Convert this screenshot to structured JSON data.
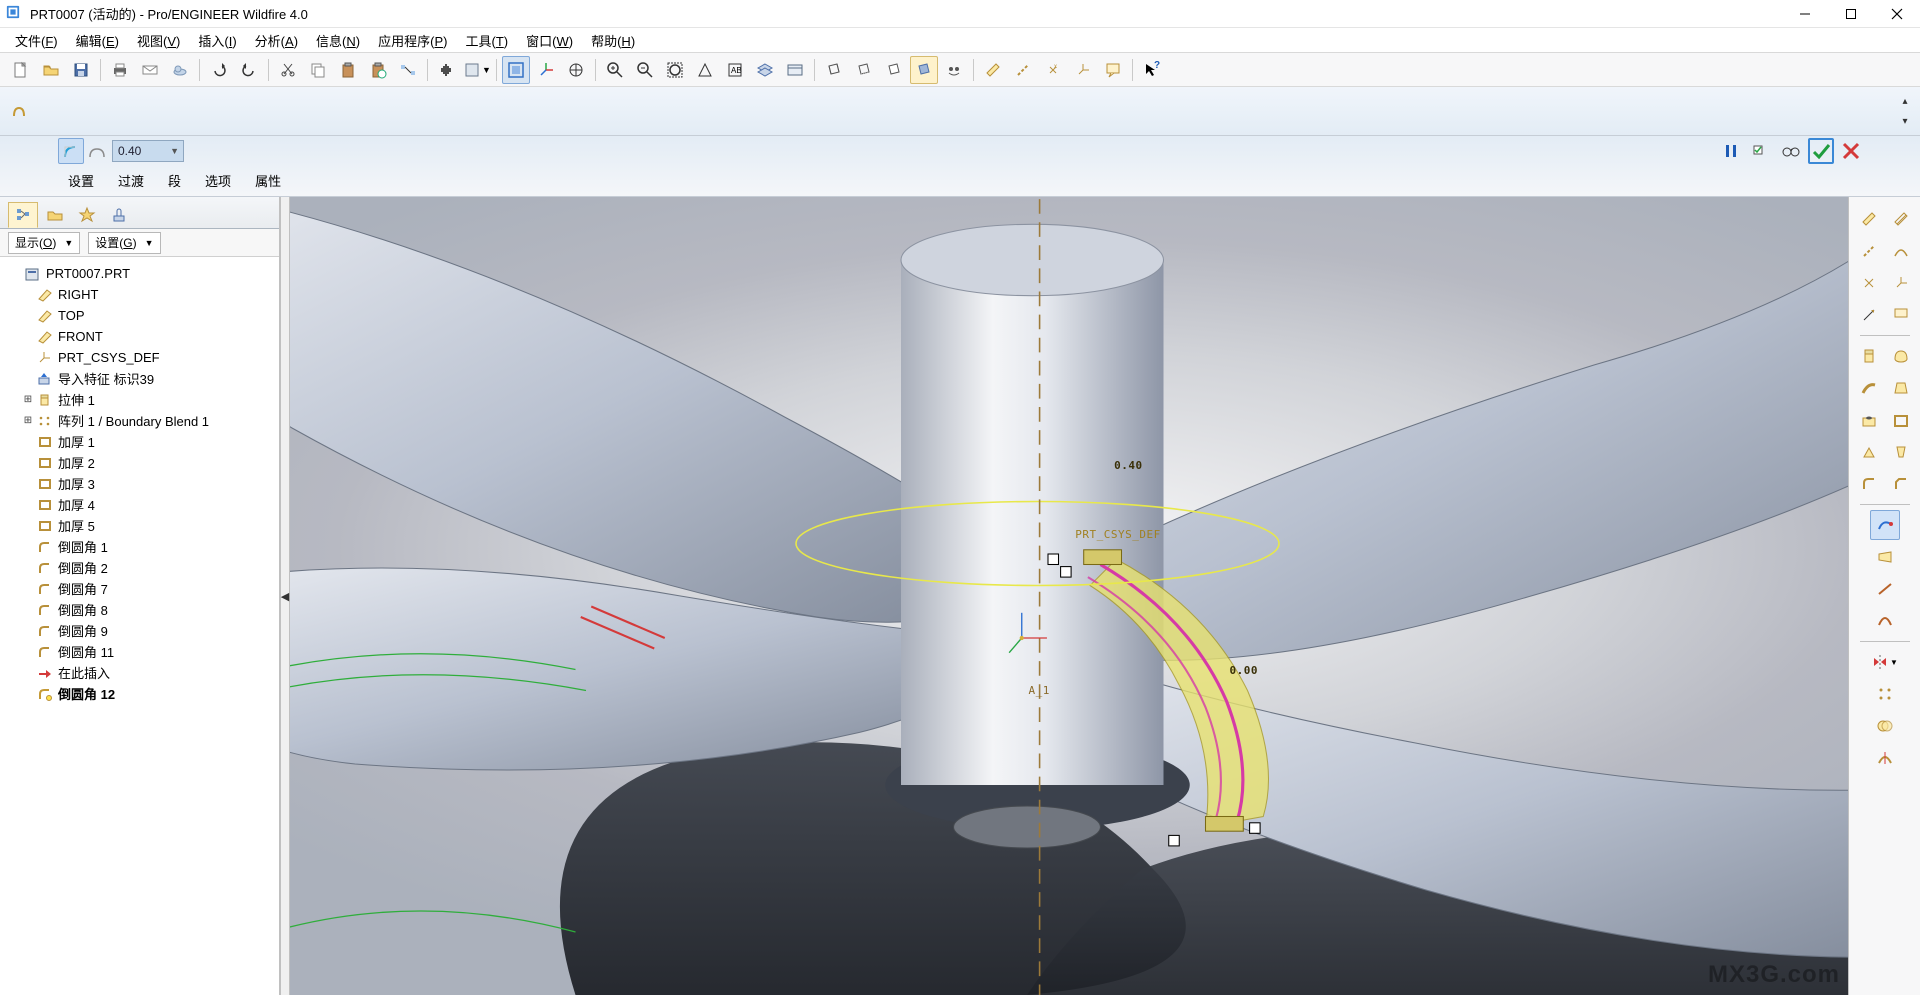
{
  "titlebar": {
    "title": "PRT0007 (活动的) - Pro/ENGINEER Wildfire 4.0"
  },
  "menubar": {
    "items": [
      {
        "label": "文件",
        "mn": "F"
      },
      {
        "label": "编辑",
        "mn": "E"
      },
      {
        "label": "视图",
        "mn": "V"
      },
      {
        "label": "插入",
        "mn": "I"
      },
      {
        "label": "分析",
        "mn": "A"
      },
      {
        "label": "信息",
        "mn": "N"
      },
      {
        "label": "应用程序",
        "mn": "P"
      },
      {
        "label": "工具",
        "mn": "T"
      },
      {
        "label": "窗口",
        "mn": "W"
      },
      {
        "label": "帮助",
        "mn": "H"
      }
    ]
  },
  "dashboard": {
    "value_field": "0.40",
    "tabs": [
      {
        "label": "设置"
      },
      {
        "label": "过渡"
      },
      {
        "label": "段"
      },
      {
        "label": "选项"
      },
      {
        "label": "属性"
      }
    ]
  },
  "tree_filters": {
    "display_label": "显示",
    "display_mn": "O",
    "settings_label": "设置",
    "settings_mn": "G"
  },
  "model_tree": {
    "root": "PRT0007.PRT",
    "items": [
      {
        "type": "datum-plane",
        "label": "RIGHT",
        "level": 2
      },
      {
        "type": "datum-plane",
        "label": "TOP",
        "level": 2
      },
      {
        "type": "datum-plane",
        "label": "FRONT",
        "level": 2
      },
      {
        "type": "csys",
        "label": "PRT_CSYS_DEF",
        "level": 2
      },
      {
        "type": "import",
        "label": "导入特征 标识39",
        "level": 2
      },
      {
        "type": "extrude",
        "label": "拉伸 1",
        "level": 2,
        "expandable": true
      },
      {
        "type": "pattern",
        "label": "阵列 1 / Boundary Blend 1",
        "level": 2,
        "expandable": true
      },
      {
        "type": "thicken",
        "label": "加厚 1",
        "level": 2
      },
      {
        "type": "thicken",
        "label": "加厚 2",
        "level": 2
      },
      {
        "type": "thicken",
        "label": "加厚 3",
        "level": 2
      },
      {
        "type": "thicken",
        "label": "加厚 4",
        "level": 2
      },
      {
        "type": "thicken",
        "label": "加厚 5",
        "level": 2
      },
      {
        "type": "round",
        "label": "倒圆角 1",
        "level": 2
      },
      {
        "type": "round",
        "label": "倒圆角 2",
        "level": 2
      },
      {
        "type": "round",
        "label": "倒圆角 7",
        "level": 2
      },
      {
        "type": "round",
        "label": "倒圆角 8",
        "level": 2
      },
      {
        "type": "round",
        "label": "倒圆角 9",
        "level": 2
      },
      {
        "type": "round",
        "label": "倒圆角 11",
        "level": 2
      },
      {
        "type": "insert-here",
        "label": "在此插入",
        "level": 2
      },
      {
        "type": "round-active",
        "label": "倒圆角 12",
        "level": 2,
        "bold": true
      }
    ]
  },
  "viewport_labels": {
    "csys": "PRT_CSYS_DEF",
    "axis": "A_1",
    "dim1": "0.40",
    "dim2": "0.00"
  },
  "watermark": "MX3G.com"
}
